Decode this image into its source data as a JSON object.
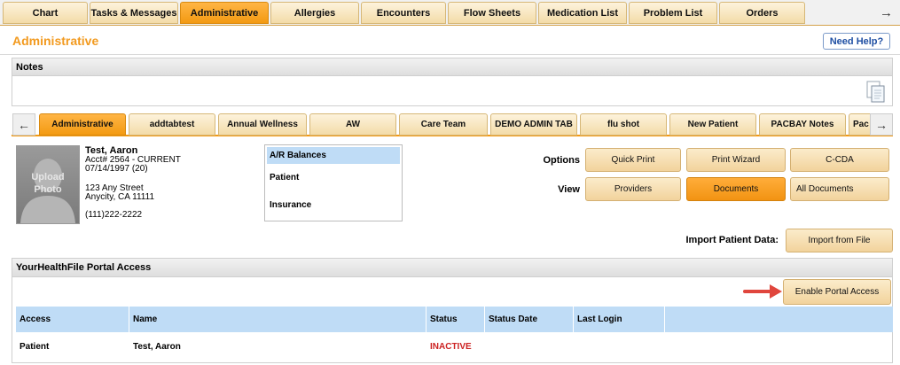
{
  "top_nav": {
    "tabs": [
      {
        "label": "Chart"
      },
      {
        "label": "Tasks & Messages"
      },
      {
        "label": "Administrative",
        "active": true
      },
      {
        "label": "Allergies"
      },
      {
        "label": "Encounters"
      },
      {
        "label": "Flow Sheets"
      },
      {
        "label": "Medication List"
      },
      {
        "label": "Problem List"
      },
      {
        "label": "Orders"
      }
    ],
    "next_arrow": "→"
  },
  "page": {
    "title": "Administrative",
    "help_label": "Need Help?"
  },
  "notes": {
    "title": "Notes"
  },
  "sub_nav": {
    "prev_arrow": "←",
    "next_arrow": "→",
    "tabs": [
      {
        "label": "Administrative",
        "active": true
      },
      {
        "label": "addtabtest"
      },
      {
        "label": "Annual Wellness"
      },
      {
        "label": "AW"
      },
      {
        "label": "Care Team"
      },
      {
        "label": "DEMO ADMIN TAB"
      },
      {
        "label": "flu shot"
      },
      {
        "label": "New Patient"
      },
      {
        "label": "PACBAY Notes"
      },
      {
        "label": "Pac"
      }
    ]
  },
  "patient": {
    "photo_label": "Upload Photo",
    "name": "Test, Aaron",
    "acct": "Acct# 2564 - CURRENT",
    "dob": "07/14/1997 (20)",
    "address1": "123 Any Street",
    "address2": "Anycity, CA 11111",
    "phone": "(111)222-2222"
  },
  "ar_menu": {
    "items": [
      {
        "label": "A/R Balances",
        "selected": true
      },
      {
        "label": "Patient"
      },
      {
        "label": "Insurance"
      }
    ]
  },
  "options": {
    "label": "Options",
    "quick_print": "Quick Print",
    "print_wizard": "Print Wizard",
    "ccda": "C-CDA"
  },
  "view": {
    "label": "View",
    "providers": "Providers",
    "documents": "Documents",
    "all_documents": "All Documents"
  },
  "import": {
    "label": "Import Patient Data:",
    "button": "Import from File"
  },
  "portal": {
    "title": "YourHealthFile Portal Access",
    "enable_button": "Enable Portal Access",
    "columns": [
      "Access",
      "Name",
      "Status",
      "Status Date",
      "Last Login",
      ""
    ],
    "rows": [
      {
        "access": "Patient",
        "name": "Test, Aaron",
        "status": "INACTIVE",
        "status_date": "",
        "last_login": ""
      }
    ]
  },
  "colors": {
    "accent": "#f39a12",
    "title": "#f29a1f",
    "table_header": "#bfdcf6",
    "inactive": "#cc2222"
  }
}
